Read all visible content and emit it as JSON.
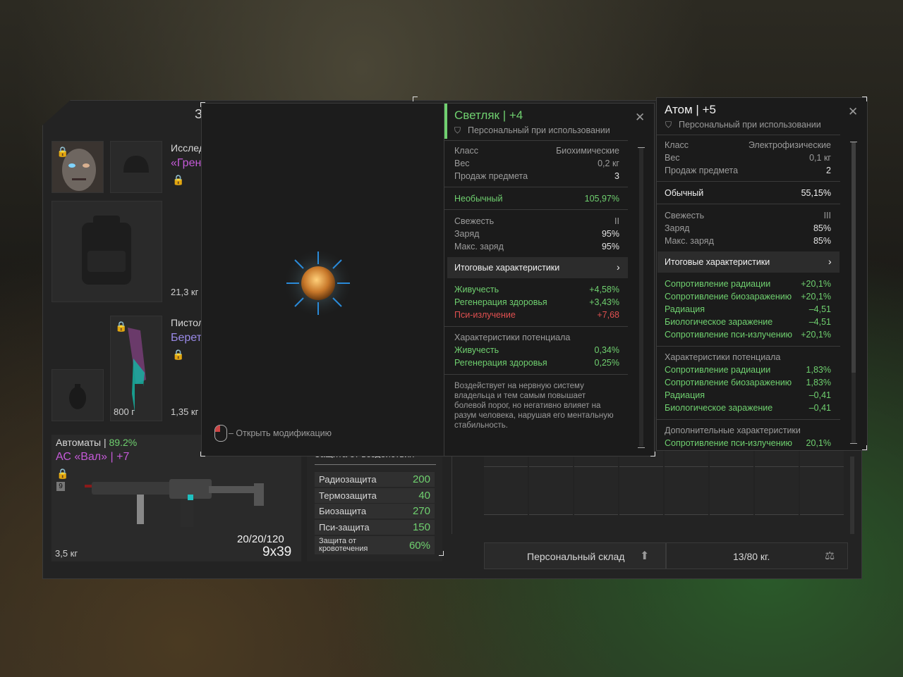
{
  "inventory": {
    "title_fragment": "З",
    "research_label": "Исслед",
    "research_name": "«Грен",
    "weight1": "21,3 кг",
    "pistol_label": "Пистол",
    "pistol_name": "Берет",
    "knife_price": "800 г",
    "pistol_weight": "1,35 кг"
  },
  "weapon": {
    "category": "Автоматы",
    "condition": "89.2%",
    "name": "АС «Вал»",
    "upgrade": "+7",
    "badge": "9",
    "ammo": "20/20/120",
    "caliber": "9x39",
    "weight": "3,5 кг"
  },
  "protection": {
    "header": "Защита от воздействия",
    "rows": [
      {
        "label": "Радиозащита",
        "value": "200"
      },
      {
        "label": "Термозащита",
        "value": "40"
      },
      {
        "label": "Биозащита",
        "value": "270"
      },
      {
        "label": "Пси-защита",
        "value": "150"
      },
      {
        "label": "Защита от кровотечения",
        "value": "60%"
      }
    ]
  },
  "storage": {
    "label": "Персональный склад",
    "weight": "13/80 кг."
  },
  "preview": {
    "hint": "– Открыть модификацию"
  },
  "svetlyak": {
    "name": "Светляк",
    "level": "+4",
    "binding": "Персональный при использовании",
    "class_label": "Класс",
    "class_value": "Биохимические",
    "weight_label": "Вес",
    "weight_value": "0,2 кг",
    "sell_label": "Продаж предмета",
    "sell_value": "3",
    "rarity": "Необычный",
    "rarity_value": "105,97%",
    "fresh_label": "Свежесть",
    "fresh_value": "II",
    "charge_label": "Заряд",
    "charge_value": "95%",
    "maxcharge_label": "Макс. заряд",
    "maxcharge_value": "95%",
    "totals_label": "Итоговые характеристики",
    "totals": [
      {
        "label": "Живучесть",
        "value": "+4,58%",
        "tone": "green"
      },
      {
        "label": "Регенерация здоровья",
        "value": "+3,43%",
        "tone": "green"
      },
      {
        "label": "Пси-излучение",
        "value": "+7,68",
        "tone": "red"
      }
    ],
    "potential_label": "Характеристики потенциала",
    "potential": [
      {
        "label": "Живучесть",
        "value": "0,34%"
      },
      {
        "label": "Регенерация здоровья",
        "value": "0,25%"
      }
    ],
    "description": "Воздействует на нервную систему владельца и тем самым повышает болевой порог, но негативно влияет на разум человека, нарушая его ментальную стабильность."
  },
  "atom": {
    "name": "Атом",
    "level": "+5",
    "binding": "Персональный при использовании",
    "class_label": "Класс",
    "class_value": "Электрофизические",
    "weight_label": "Вес",
    "weight_value": "0,1 кг",
    "sell_label": "Продаж предмета",
    "sell_value": "2",
    "rarity": "Обычный",
    "rarity_value": "55,15%",
    "fresh_label": "Свежесть",
    "fresh_value": "III",
    "charge_label": "Заряд",
    "charge_value": "85%",
    "maxcharge_label": "Макс. заряд",
    "maxcharge_value": "85%",
    "totals_label": "Итоговые характеристики",
    "totals": [
      {
        "label": "Сопротивление радиации",
        "value": "+20,1%"
      },
      {
        "label": "Сопротивление биозаражению",
        "value": "+20,1%"
      },
      {
        "label": "Радиация",
        "value": "–4,51"
      },
      {
        "label": "Биологическое заражение",
        "value": "–4,51"
      },
      {
        "label": "Сопротивление пси-излучению",
        "value": "+20,1%"
      }
    ],
    "potential_label": "Характеристики потенциала",
    "potential": [
      {
        "label": "Сопротивление радиации",
        "value": "1,83%"
      },
      {
        "label": "Сопротивление биозаражению",
        "value": "1,83%"
      },
      {
        "label": "Радиация",
        "value": "–0,41"
      },
      {
        "label": "Биологическое заражение",
        "value": "–0,41"
      }
    ],
    "extra_label": "Дополнительные характеристики",
    "extra": [
      {
        "label": "Сопротивление пси-излучению",
        "value": "20,1%"
      }
    ]
  },
  "colors": {
    "accent_green": "#6fd06f",
    "red": "#e05050",
    "purple": "#c55ad8",
    "violet": "#9a8ae8"
  }
}
